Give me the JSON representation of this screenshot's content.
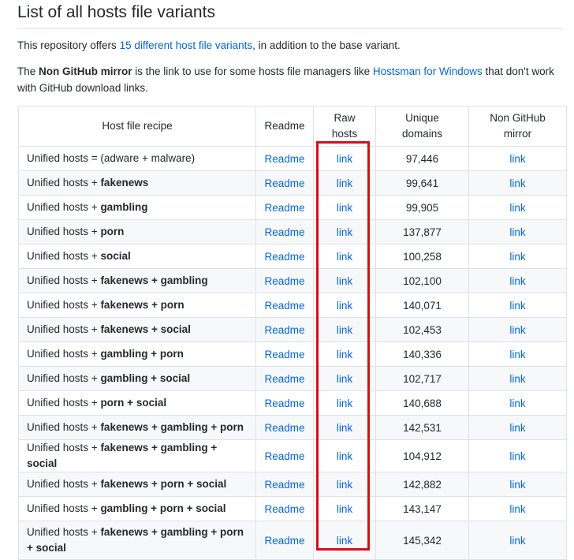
{
  "heading": "List of all hosts file variants",
  "intro": {
    "pre": "This repository offers ",
    "link": "15 different host file variants",
    "post": ", in addition to the base variant."
  },
  "note": {
    "pre": "The ",
    "bold": "Non GitHub mirror",
    "mid": " is the link to use for some hosts file managers like ",
    "link": "Hostsman for Windows",
    "post": " that don't work with GitHub download links."
  },
  "table": {
    "headers": [
      "Host file recipe",
      "Readme",
      "Raw hosts",
      "Unique domains",
      "Non GitHub mirror"
    ],
    "readme_label": "Readme",
    "link_label": "link",
    "rows": [
      {
        "base": "Unified hosts = (adware + malware)",
        "ext": "",
        "domains": "97,446"
      },
      {
        "base": "Unified hosts + ",
        "ext": "fakenews",
        "domains": "99,641"
      },
      {
        "base": "Unified hosts + ",
        "ext": "gambling",
        "domains": "99,905"
      },
      {
        "base": "Unified hosts + ",
        "ext": "porn",
        "domains": "137,877"
      },
      {
        "base": "Unified hosts + ",
        "ext": "social",
        "domains": "100,258"
      },
      {
        "base": "Unified hosts + ",
        "ext": "fakenews + gambling",
        "domains": "102,100"
      },
      {
        "base": "Unified hosts + ",
        "ext": "fakenews + porn",
        "domains": "140,071"
      },
      {
        "base": "Unified hosts + ",
        "ext": "fakenews + social",
        "domains": "102,453"
      },
      {
        "base": "Unified hosts + ",
        "ext": "gambling + porn",
        "domains": "140,336"
      },
      {
        "base": "Unified hosts + ",
        "ext": "gambling + social",
        "domains": "102,717"
      },
      {
        "base": "Unified hosts + ",
        "ext": "porn + social",
        "domains": "140,688"
      },
      {
        "base": "Unified hosts + ",
        "ext": "fakenews + gambling + porn",
        "domains": "142,531"
      },
      {
        "base": "Unified hosts + ",
        "ext": "fakenews + gambling + social",
        "domains": "104,912"
      },
      {
        "base": "Unified hosts + ",
        "ext": "fakenews + porn + social",
        "domains": "142,882"
      },
      {
        "base": "Unified hosts + ",
        "ext": "gambling + porn + social",
        "domains": "143,147"
      },
      {
        "base": "Unified hosts + ",
        "ext": "fakenews + gambling + porn + social",
        "domains": "145,342"
      }
    ]
  }
}
